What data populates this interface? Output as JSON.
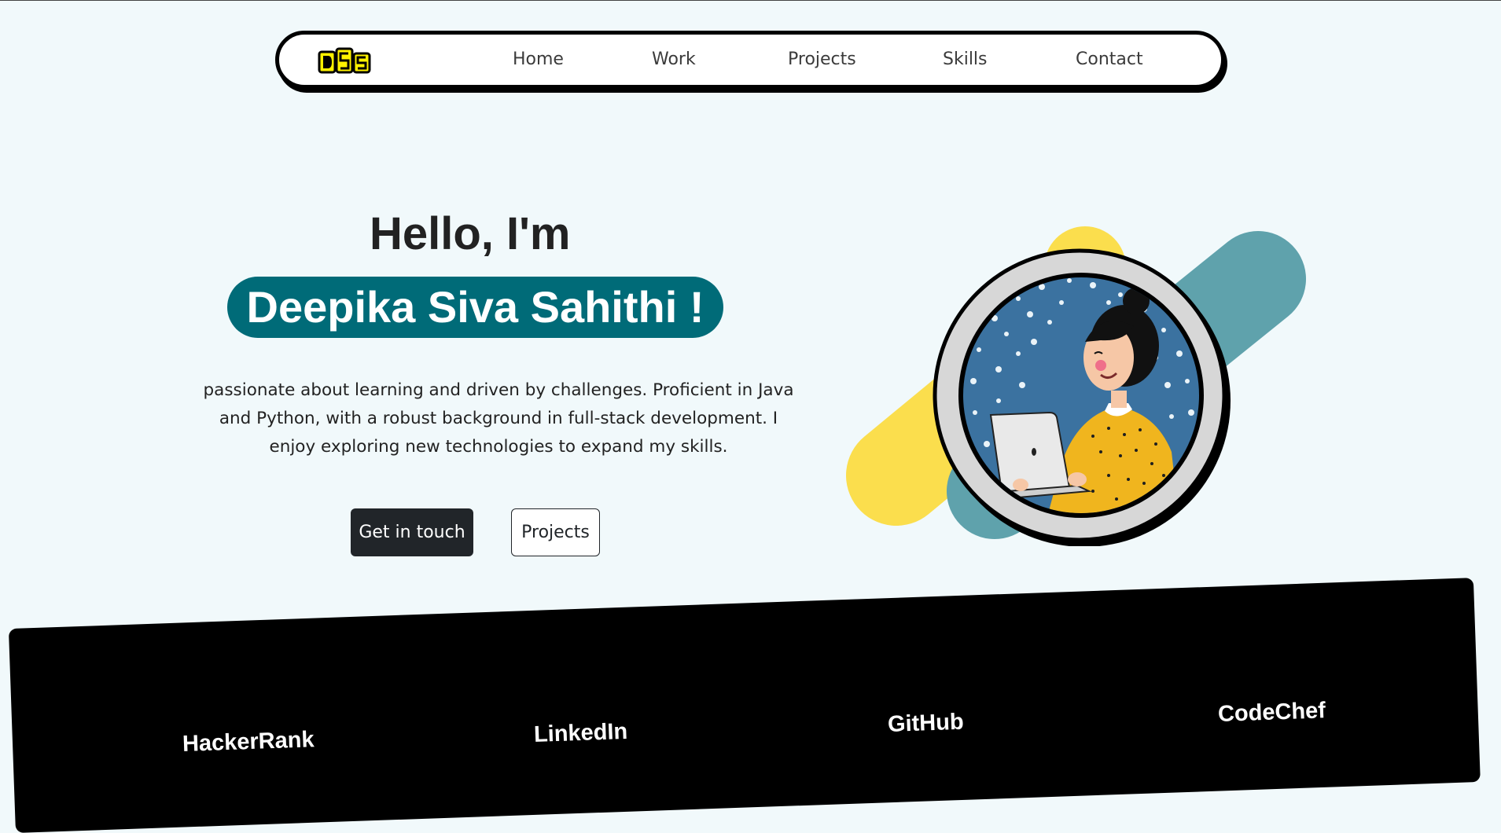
{
  "nav": {
    "logo_text": "DSS",
    "links": [
      "Home",
      "Work",
      "Projects",
      "Skills",
      "Contact"
    ]
  },
  "hero": {
    "greeting": "Hello, I'm",
    "name": "Deepika Siva Sahithi !",
    "bio": "passionate about learning and driven by challenges. Proficient in Java and Python, with a robust background in full-stack development. I enjoy exploring new technologies to expand my skills.",
    "primary_button": "Get in touch",
    "secondary_button": "Projects"
  },
  "profiles": {
    "links": [
      "HackerRank",
      "LinkedIn",
      "GitHub",
      "CodeChef"
    ]
  },
  "colors": {
    "page_bg": "#f1f9fb",
    "accent_teal": "#006b78",
    "accent_yellow": "#fbde4d",
    "accent_blue_gray": "#5fa2ac",
    "dark_button": "#212529"
  },
  "icons": {
    "logo": "dss-logo-icon",
    "illustration": "woman-with-laptop-illustration"
  }
}
